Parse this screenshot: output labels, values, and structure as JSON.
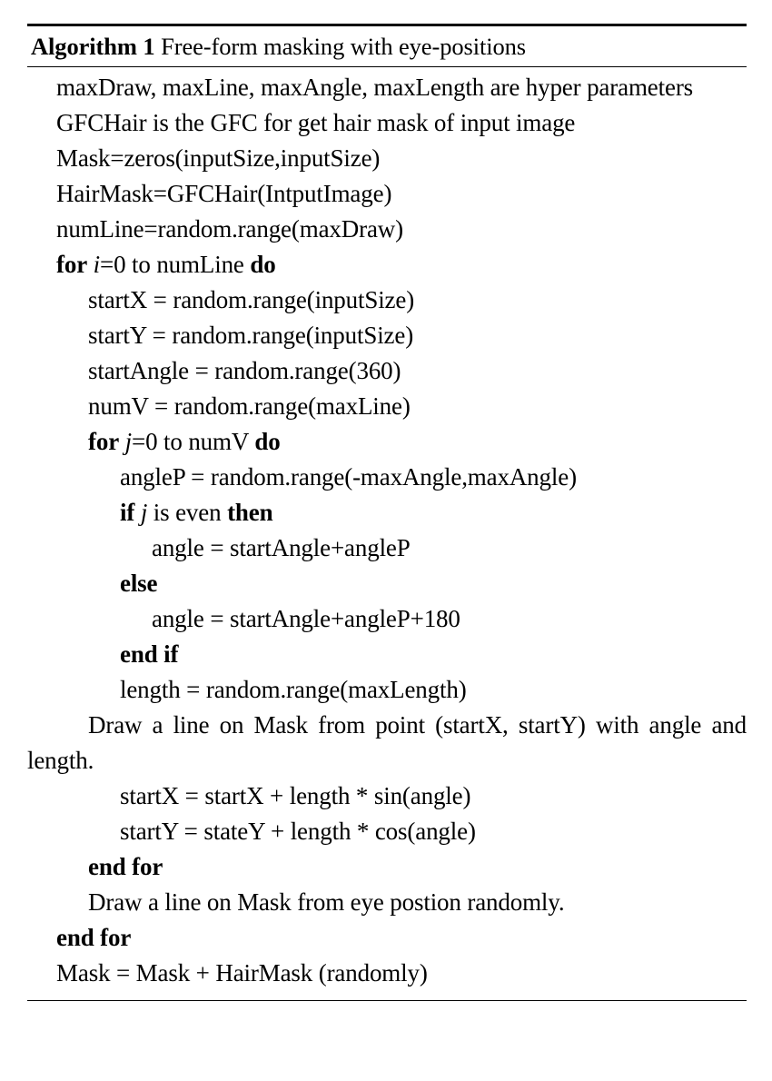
{
  "algorithm": {
    "label": "Algorithm 1",
    "title": "Free-form masking with eye-positions",
    "lines": [
      {
        "id": "hyperparams",
        "text": "maxDraw, maxLine, maxAngle, maxLength are hyper parameters"
      },
      {
        "id": "gfchair-desc",
        "text": "GFCHair is the GFC for get hair mask of input image"
      },
      {
        "id": "mask-init",
        "text": "Mask=zeros(inputSize,inputSize)"
      },
      {
        "id": "hairmask-init",
        "text": "HairMask=GFCHair(IntputImage)"
      },
      {
        "id": "numline-init",
        "text": "numLine=random.range(maxDraw)"
      },
      {
        "id": "for-i",
        "kw1": "for",
        "var": "i",
        "mid": "=0 to numLine",
        "kw2": "do"
      },
      {
        "id": "startx-init",
        "text": "startX = random.range(inputSize)"
      },
      {
        "id": "starty-init",
        "text": "startY = random.range(inputSize)"
      },
      {
        "id": "startangle-init",
        "text": "startAngle = random.range(360)"
      },
      {
        "id": "numv-init",
        "text": "numV = random.range(maxLine)"
      },
      {
        "id": "for-j",
        "kw1": "for",
        "var": "j",
        "mid": "=0 to numV",
        "kw2": "do"
      },
      {
        "id": "anglep-init",
        "text": "angleP = random.range(-maxAngle,maxAngle)"
      },
      {
        "id": "if-even",
        "kw1": "if",
        "var": "j",
        "mid": " is even ",
        "kw2": "then"
      },
      {
        "id": "angle-even",
        "text": "angle = startAngle+angleP"
      },
      {
        "id": "else",
        "kw1": "else"
      },
      {
        "id": "angle-odd",
        "text": "angle = startAngle+angleP+180"
      },
      {
        "id": "end-if",
        "kw1": "end if"
      },
      {
        "id": "length-init",
        "text": "length = random.range(maxLength)"
      },
      {
        "id": "draw-line-point",
        "text": "Draw a line on Mask from point (startX, startY) with angle and length."
      },
      {
        "id": "startx-update",
        "text": "startX = startX + length * sin(angle)"
      },
      {
        "id": "starty-update",
        "text": "startY = stateY + length * cos(angle)"
      },
      {
        "id": "end-for-inner",
        "kw1": "end for"
      },
      {
        "id": "draw-line-eye",
        "text": "Draw a line on Mask from eye postion randomly."
      },
      {
        "id": "end-for-outer",
        "kw1": "end for"
      },
      {
        "id": "mask-final",
        "text": "Mask = Mask + HairMask (randomly)"
      }
    ]
  }
}
